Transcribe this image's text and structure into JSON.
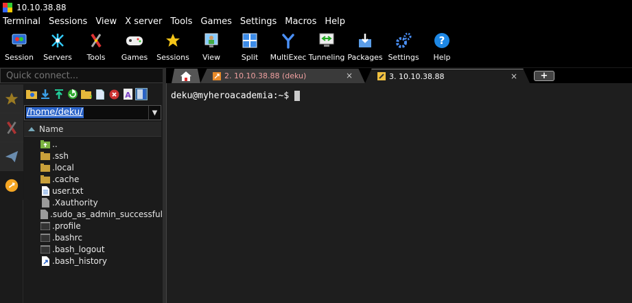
{
  "window": {
    "title": "10.10.38.88"
  },
  "menu": [
    "Terminal",
    "Sessions",
    "View",
    "X server",
    "Tools",
    "Games",
    "Settings",
    "Macros",
    "Help"
  ],
  "toolbar": [
    {
      "label": "Session",
      "icon": "session-icon"
    },
    {
      "label": "Servers",
      "icon": "servers-icon"
    },
    {
      "label": "Tools",
      "icon": "tools-icon"
    },
    {
      "label": "Games",
      "icon": "games-icon"
    },
    {
      "label": "Sessions",
      "icon": "star-icon"
    },
    {
      "label": "View",
      "icon": "view-icon"
    },
    {
      "label": "Split",
      "icon": "split-icon"
    },
    {
      "label": "MultiExec",
      "icon": "multiexec-icon"
    },
    {
      "label": "Tunneling",
      "icon": "tunneling-icon"
    },
    {
      "label": "Packages",
      "icon": "packages-icon"
    },
    {
      "label": "Settings",
      "icon": "settings-icon"
    },
    {
      "label": "Help",
      "icon": "help-icon"
    }
  ],
  "quick_connect": {
    "placeholder": "Quick connect..."
  },
  "browser": {
    "path": "/home/deku/",
    "column_name": "Name",
    "files": [
      {
        "name": "..",
        "type": "parent"
      },
      {
        "name": ".ssh",
        "type": "folder"
      },
      {
        "name": ".local",
        "type": "folder"
      },
      {
        "name": ".cache",
        "type": "folder"
      },
      {
        "name": "user.txt",
        "type": "text"
      },
      {
        "name": ".Xauthority",
        "type": "file"
      },
      {
        "name": ".sudo_as_admin_successful",
        "type": "file"
      },
      {
        "name": ".profile",
        "type": "shell"
      },
      {
        "name": ".bashrc",
        "type": "shell"
      },
      {
        "name": ".bash_logout",
        "type": "shell"
      },
      {
        "name": ".bash_history",
        "type": "link"
      }
    ]
  },
  "tabs": [
    {
      "label": "2. 10.10.38.88 (deku)",
      "close": "×"
    },
    {
      "label": "3. 10.10.38.88",
      "close": "×"
    }
  ],
  "new_tab": "+",
  "terminal": {
    "prompt": "deku@myheroacademia:~$"
  },
  "colors": {
    "path_highlight": "#2a63c8",
    "folder": "#c9a03a",
    "tab_inactive_text": "#f0a0a0"
  }
}
